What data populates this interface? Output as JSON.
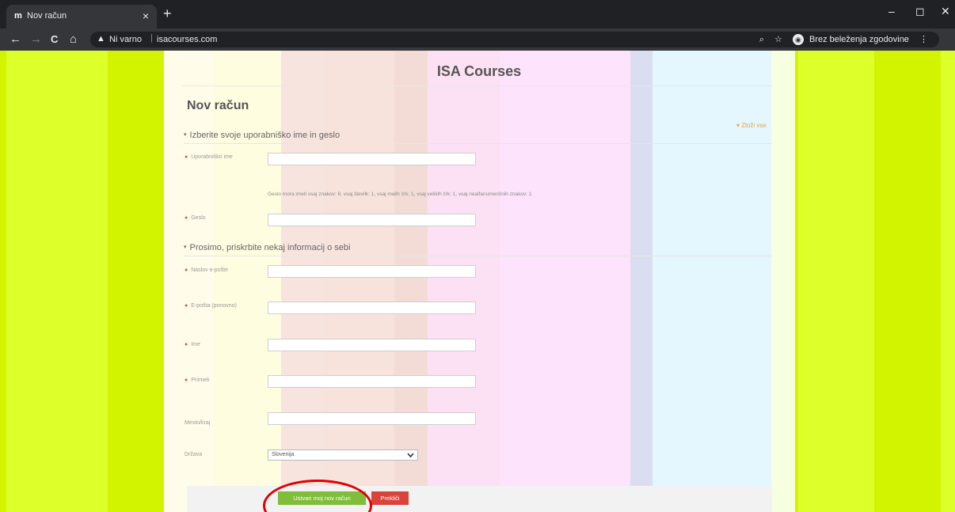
{
  "browser": {
    "tab_favicon": "m",
    "tab_title": "Nov račun",
    "tab_close": "×",
    "new_tab": "+",
    "window_controls": {
      "minimize": "–",
      "restore": "◻",
      "close": "✕"
    },
    "nav": {
      "back": "←",
      "forward": "→",
      "reload": "C",
      "home": "⌂"
    },
    "security_icon": "warning-triangle-icon",
    "security_glyph": "▲",
    "security_text": "Ni varno",
    "url_separator": "|",
    "url": "isacourses.com",
    "zoom_glyph": "⌕",
    "bookmark_glyph": "☆",
    "incognito_glyph": "◉",
    "incognito_label": "Brez beleženja zgodovine",
    "menu_glyph": "⋮"
  },
  "page": {
    "site_title": "ISA Courses",
    "title": "Nov račun",
    "collapse_all": "▾ Zloži vse",
    "section1_legend": "Izberite svoje uporabniško ime in geslo",
    "section2_legend": "Prosimo, priskrbite nekaj informacij o sebi",
    "section_marker": "▾",
    "required_marker": "●",
    "password_hint": "Geslo mora imeti vsaj znakov: 8, vsaj številk: 1, vsaj malih črk: 1, vsaj velikih črk: 1, vsaj nealfanumeričnih znakov: 1",
    "fields": {
      "username": {
        "label": "Uporabniško ime",
        "value": ""
      },
      "password": {
        "label": "Geslo",
        "value": ""
      },
      "email": {
        "label": "Naslov e-pošte",
        "value": ""
      },
      "email2": {
        "label": "E-pošta (ponovno)",
        "value": ""
      },
      "firstname": {
        "label": "Ime",
        "value": ""
      },
      "lastname": {
        "label": "Priimek",
        "value": ""
      },
      "city": {
        "label": "Mesto/kraj",
        "value": ""
      },
      "country": {
        "label": "Država",
        "value": "Slovenija"
      }
    },
    "submit_label": "Ustvari moj nov račun",
    "cancel_label": "Prekliči"
  },
  "colors": {
    "page_background": "#d2f400",
    "submit": "#7fbd3a",
    "cancel": "#d9433a",
    "highlight": "#e00000"
  }
}
